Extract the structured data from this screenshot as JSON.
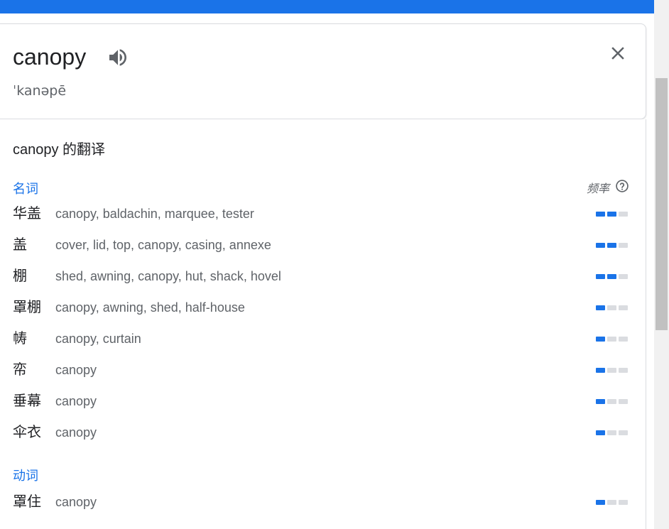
{
  "entry": {
    "word": "canopy",
    "phonetic": "ˈkanəpē",
    "speaker_icon": "speaker-icon",
    "close_icon": "close-icon"
  },
  "translations": {
    "title": "canopy 的翻译",
    "frequency_label": "频率",
    "help_icon": "help-circle-icon",
    "groups": [
      {
        "pos": "名词",
        "rows": [
          {
            "zh": "华盖",
            "en": "canopy, baldachin, marquee, tester",
            "freq": 2
          },
          {
            "zh": "盖",
            "en": "cover, lid, top, canopy, casing, annexe",
            "freq": 2
          },
          {
            "zh": "棚",
            "en": "shed, awning, canopy, hut, shack, hovel",
            "freq": 2
          },
          {
            "zh": "罩棚",
            "en": "canopy, awning, shed, half-house",
            "freq": 1
          },
          {
            "zh": "帱",
            "en": "canopy, curtain",
            "freq": 1
          },
          {
            "zh": "帟",
            "en": "canopy",
            "freq": 1
          },
          {
            "zh": "垂幕",
            "en": "canopy",
            "freq": 1
          },
          {
            "zh": "伞衣",
            "en": "canopy",
            "freq": 1
          }
        ]
      },
      {
        "pos": "动词",
        "rows": [
          {
            "zh": "罩住",
            "en": "canopy",
            "freq": 1
          }
        ]
      }
    ]
  },
  "colors": {
    "accent": "#1a73e8",
    "bar_off": "#dadce0",
    "text_secondary": "#5f6368"
  }
}
